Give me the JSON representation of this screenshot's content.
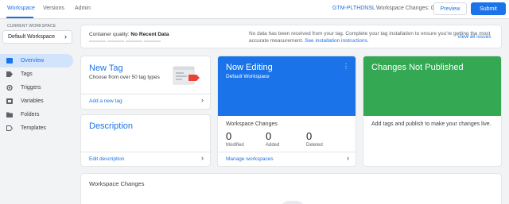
{
  "topbar": {
    "tabs": [
      {
        "label": "Workspace",
        "active": true
      },
      {
        "label": "Versions",
        "active": false
      },
      {
        "label": "Admin",
        "active": false
      }
    ],
    "container_id": "GTM-PLTHDNSL",
    "workspace_changes": "Workspace Changes: 0",
    "preview_label": "Preview",
    "submit_label": "Submit"
  },
  "sidebar": {
    "current_workspace_label": "CURRENT WORKSPACE",
    "workspace_name": "Default Workspace",
    "items": [
      {
        "label": "Overview",
        "icon": "overview-icon",
        "active": true
      },
      {
        "label": "Tags",
        "icon": "tag-icon",
        "active": false
      },
      {
        "label": "Triggers",
        "icon": "trigger-icon",
        "active": false
      },
      {
        "label": "Variables",
        "icon": "variables-icon",
        "active": false
      },
      {
        "label": "Folders",
        "icon": "folder-icon",
        "active": false
      },
      {
        "label": "Templates",
        "icon": "template-icon",
        "active": false
      }
    ]
  },
  "quality": {
    "label": "Container quality:",
    "value": "No Recent Data",
    "message": "No data has been received from your tag. Complete your tag installation to ensure you're getting the most accurate measurement.",
    "link": "See installation instructions.",
    "view_issues": "View all issues"
  },
  "new_tag": {
    "title": "New Tag",
    "subtitle": "Choose from over 50 tag types",
    "link": "Add a new tag"
  },
  "description": {
    "title": "Description",
    "link": "Edit description"
  },
  "now_editing": {
    "title": "Now Editing",
    "workspace": "Default Workspace",
    "changes_label": "Workspace Changes",
    "stats": [
      {
        "value": "0",
        "label": "Modified"
      },
      {
        "value": "0",
        "label": "Added"
      },
      {
        "value": "0",
        "label": "Deleted"
      }
    ],
    "link": "Manage workspaces"
  },
  "not_published": {
    "title": "Changes Not Published",
    "text": "Add tags and publish to make your changes live."
  },
  "workspace_changes_card": {
    "title": "Workspace Changes"
  },
  "colors": {
    "accent": "#1a73e8",
    "published_green": "#34a853",
    "background": "#f1f3f4"
  }
}
